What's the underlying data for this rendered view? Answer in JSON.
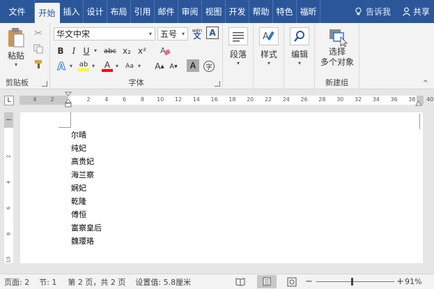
{
  "tabs": [
    "文件",
    "开始",
    "插入",
    "设计",
    "布局",
    "引用",
    "邮件",
    "审阅",
    "视图",
    "开发",
    "帮助",
    "特色",
    "福昕"
  ],
  "tell_me": "告诉我",
  "share": "共享",
  "clipboard": {
    "paste": "粘贴",
    "label": "剪贴板"
  },
  "font": {
    "name": "华文中宋",
    "size": "五号",
    "label": "字体",
    "bold": "B",
    "italic": "I",
    "underline": "U",
    "strike": "abc",
    "sub": "x₂",
    "sup": "x²",
    "grow": "A",
    "shrink": "A",
    "shade": "A",
    "phonetic": "wén",
    "enclose": "字"
  },
  "paragraph": {
    "label": "段落"
  },
  "styles": {
    "label": "样式"
  },
  "editing": {
    "label": "编辑"
  },
  "newgroup": {
    "btn1": "选择",
    "btn2": "多个对象",
    "label": "新建组"
  },
  "ruler": {
    "ticks": [
      "4",
      "2",
      "2",
      "4",
      "6",
      "8",
      "10",
      "12",
      "14",
      "16",
      "18",
      "20",
      "22",
      "24",
      "26",
      "28",
      "30",
      "32",
      "34",
      "36",
      "38",
      "40"
    ]
  },
  "vruler": {
    "ticks": [
      "2",
      "4",
      "6",
      "8",
      "10"
    ]
  },
  "document": {
    "lines": [
      "尔晴",
      "纯妃",
      "高贵妃",
      "海兰察",
      "娴妃",
      "乾隆",
      "傅恒",
      "富察皇后",
      "魏璎珞"
    ]
  },
  "status": {
    "page": "页面: 2",
    "section": "节: 1",
    "pages": "第 2 页，共 2 页",
    "setting": "设置值: 5.8厘米",
    "zoom": "91%",
    "minus": "−",
    "plus": "+"
  },
  "colors": {
    "brand": "#2b579a",
    "highlight": "#ffff00",
    "fontcolor": "#ff0000"
  }
}
